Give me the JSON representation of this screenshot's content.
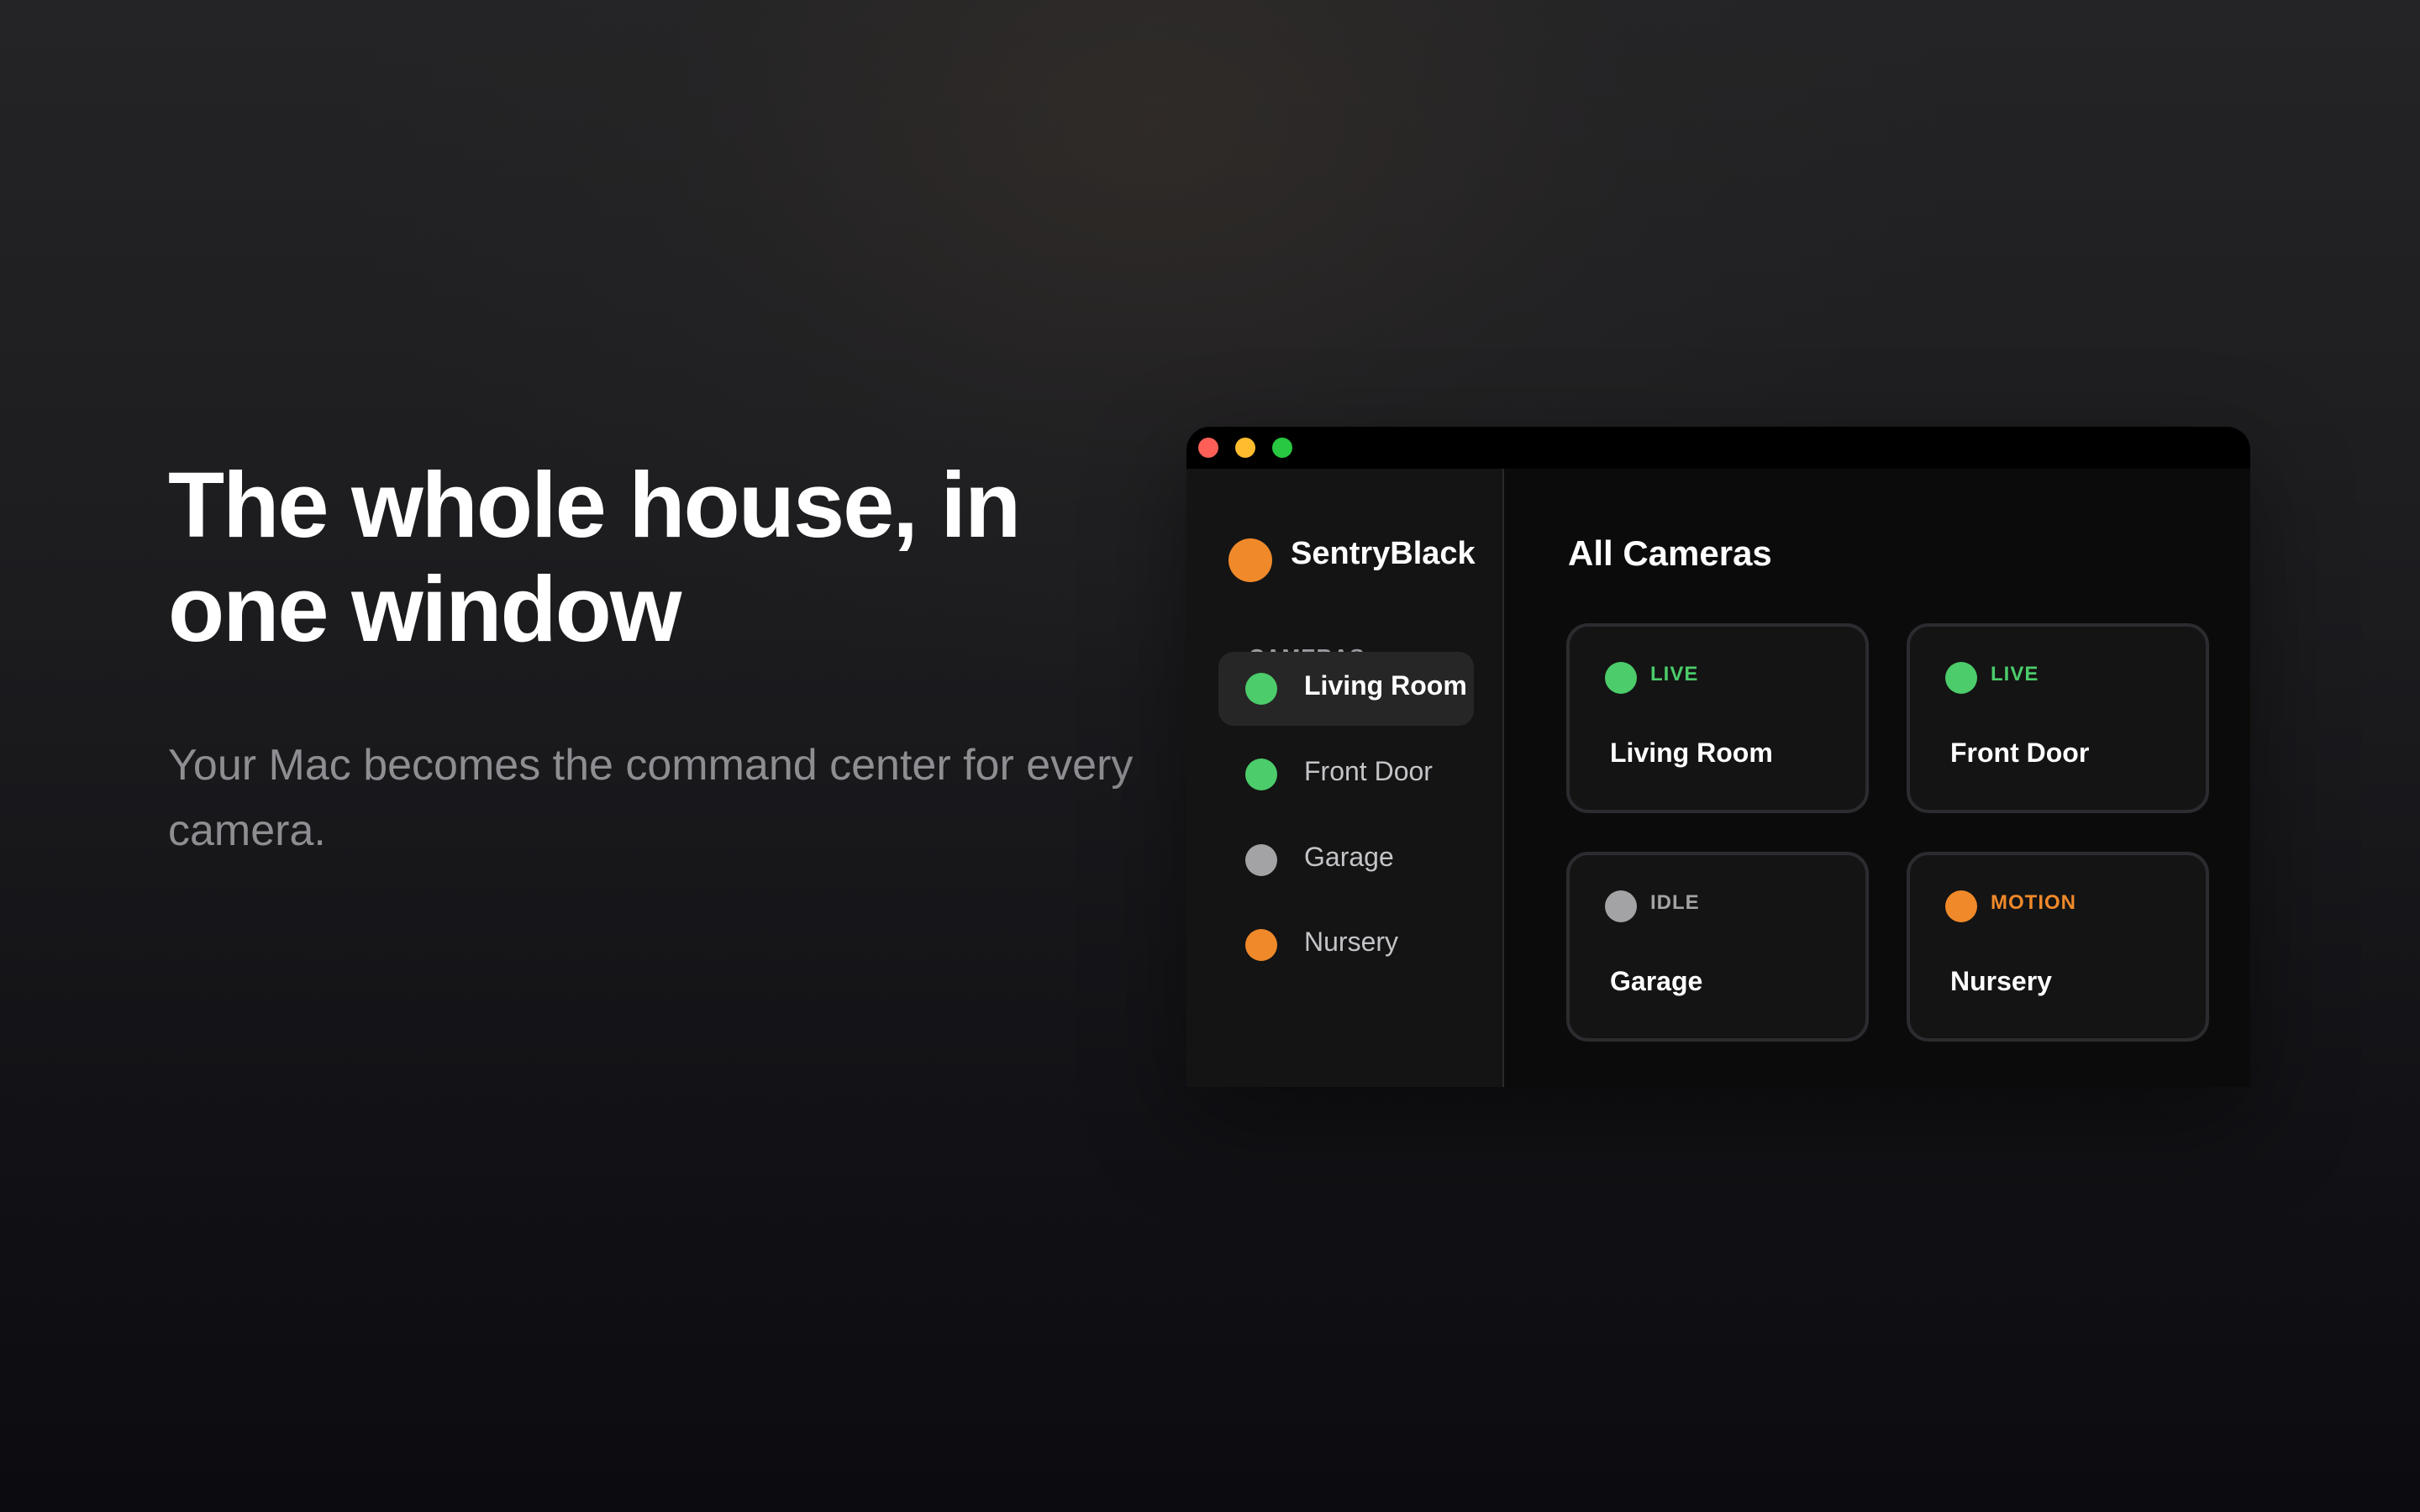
{
  "colors": {
    "live": "#4ccc6a",
    "idle": "#a3a3a6",
    "motion": "#f0892a",
    "brand": "#f0892a"
  },
  "hero": {
    "headline": "The whole house, in one window",
    "subtext": "Your Mac becomes the command center for every camera."
  },
  "window": {
    "controls": [
      "close",
      "minimize",
      "zoom"
    ]
  },
  "sidebar": {
    "brand": "SentryBlack",
    "section_label": "CAMERAS",
    "items": [
      {
        "label": "Living Room",
        "status": "live",
        "active": true
      },
      {
        "label": "Front Door",
        "status": "live",
        "active": false
      },
      {
        "label": "Garage",
        "status": "idle",
        "active": false
      },
      {
        "label": "Nursery",
        "status": "motion",
        "active": false
      }
    ]
  },
  "main": {
    "title": "All Cameras",
    "cards": [
      {
        "status_label": "LIVE",
        "name": "Living Room",
        "status": "live"
      },
      {
        "status_label": "LIVE",
        "name": "Front Door",
        "status": "live"
      },
      {
        "status_label": "IDLE",
        "name": "Garage",
        "status": "idle"
      },
      {
        "status_label": "MOTION",
        "name": "Nursery",
        "status": "motion"
      }
    ]
  }
}
